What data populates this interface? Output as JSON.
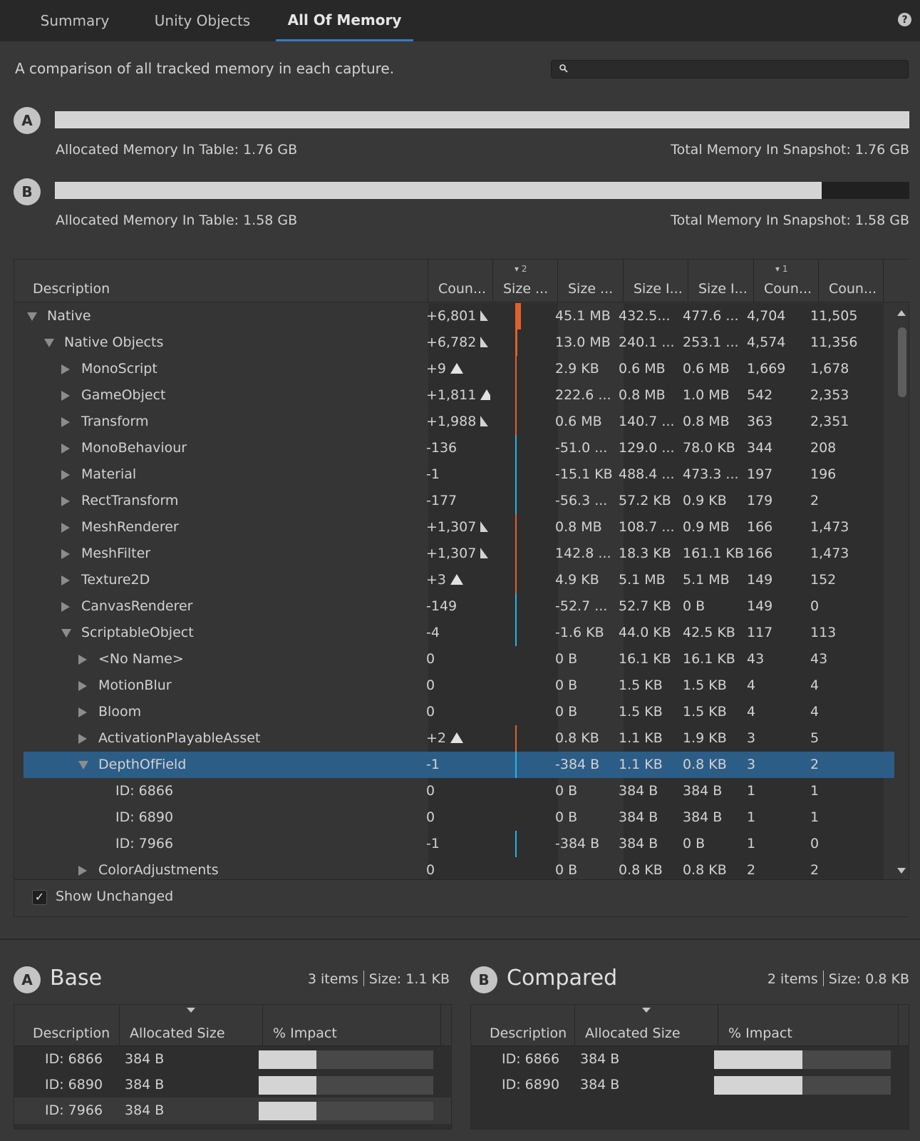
{
  "tabs": [
    {
      "label": "Summary",
      "active": false
    },
    {
      "label": "Unity Objects",
      "active": false
    },
    {
      "label": "All Of Memory",
      "active": true
    }
  ],
  "help_icon": "question-icon",
  "description": "A comparison of all tracked memory in each capture.",
  "search": {
    "placeholder": "",
    "value": ""
  },
  "captures": [
    {
      "badge": "A",
      "allocated": "Allocated Memory In Table: 1.76 GB",
      "total": "Total Memory In Snapshot: 1.76 GB",
      "fill_fraction": 1.0
    },
    {
      "badge": "B",
      "allocated": "Allocated Memory In Table: 1.58 GB",
      "total": "Total Memory In Snapshot: 1.58 GB",
      "fill_fraction": 0.897
    }
  ],
  "table": {
    "columns": [
      {
        "label": "Description",
        "sort": ""
      },
      {
        "label": "Coun...",
        "sort": ""
      },
      {
        "label": "Size ...",
        "sort": "▾ 2"
      },
      {
        "label": "Size ...",
        "sort": ""
      },
      {
        "label": "Size I...",
        "sort": ""
      },
      {
        "label": "Size I...",
        "sort": ""
      },
      {
        "label": "Coun...",
        "sort": "▾ 1"
      },
      {
        "label": "Coun...",
        "sort": ""
      }
    ],
    "colors": {
      "increase": "#e0602c",
      "decrease": "#2ab4de",
      "selected": "#2c5d87"
    },
    "rows": [
      {
        "depth": 0,
        "expander": "down",
        "desc": "Native",
        "count_diff": "+6,801",
        "arrow": "small",
        "diff": "increase",
        "diff_width": 8,
        "size_diff": "45.1 MB",
        "size_a": "432.5...",
        "size_b": "477.6 ...",
        "count_a": "4,704",
        "count_b": "11,505"
      },
      {
        "depth": 1,
        "expander": "down",
        "desc": "Native Objects",
        "count_diff": "+6,782",
        "arrow": "small",
        "diff": "increase",
        "diff_width": 3,
        "size_diff": "13.0 MB",
        "size_a": "240.1 ...",
        "size_b": "253.1 ...",
        "count_a": "4,574",
        "count_b": "11,356"
      },
      {
        "depth": 2,
        "expander": "right",
        "desc": "MonoScript",
        "count_diff": "+9",
        "arrow": "big",
        "diff": "increase",
        "diff_width": 2,
        "size_diff": "2.9 KB",
        "size_a": "0.6 MB",
        "size_b": "0.6 MB",
        "count_a": "1,669",
        "count_b": "1,678"
      },
      {
        "depth": 2,
        "expander": "right",
        "desc": "GameObject",
        "count_diff": "+1,811",
        "arrow": "big",
        "diff": "increase",
        "diff_width": 2,
        "size_diff": "222.6 ...",
        "size_a": "0.8 MB",
        "size_b": "1.0 MB",
        "count_a": "542",
        "count_b": "2,353"
      },
      {
        "depth": 2,
        "expander": "right",
        "desc": "Transform",
        "count_diff": "+1,988",
        "arrow": "small",
        "diff": "increase",
        "diff_width": 2,
        "size_diff": "0.6 MB",
        "size_a": "140.7 ...",
        "size_b": "0.8 MB",
        "count_a": "363",
        "count_b": "2,351"
      },
      {
        "depth": 2,
        "expander": "right",
        "desc": "MonoBehaviour",
        "count_diff": "-136",
        "arrow": "",
        "diff": "decrease",
        "diff_width": 2,
        "size_diff": "-51.0 ...",
        "size_a": "129.0 ...",
        "size_b": "78.0 KB",
        "count_a": "344",
        "count_b": "208"
      },
      {
        "depth": 2,
        "expander": "right",
        "desc": "Material",
        "count_diff": "-1",
        "arrow": "",
        "diff": "decrease",
        "diff_width": 2,
        "size_diff": "-15.1 KB",
        "size_a": "488.4 ...",
        "size_b": "473.3 ...",
        "count_a": "197",
        "count_b": "196"
      },
      {
        "depth": 2,
        "expander": "right",
        "desc": "RectTransform",
        "count_diff": "-177",
        "arrow": "",
        "diff": "decrease",
        "diff_width": 2,
        "size_diff": "-56.3 ...",
        "size_a": "57.2 KB",
        "size_b": "0.9 KB",
        "count_a": "179",
        "count_b": "2"
      },
      {
        "depth": 2,
        "expander": "right",
        "desc": "MeshRenderer",
        "count_diff": "+1,307",
        "arrow": "small",
        "diff": "increase",
        "diff_width": 2,
        "size_diff": "0.8 MB",
        "size_a": "108.7 ...",
        "size_b": "0.9 MB",
        "count_a": "166",
        "count_b": "1,473"
      },
      {
        "depth": 2,
        "expander": "right",
        "desc": "MeshFilter",
        "count_diff": "+1,307",
        "arrow": "small",
        "diff": "increase",
        "diff_width": 2,
        "size_diff": "142.8 ...",
        "size_a": "18.3 KB",
        "size_b": "161.1 KB",
        "count_a": "166",
        "count_b": "1,473"
      },
      {
        "depth": 2,
        "expander": "right",
        "desc": "Texture2D",
        "count_diff": "+3",
        "arrow": "big",
        "diff": "increase",
        "diff_width": 2,
        "size_diff": "4.9 KB",
        "size_a": "5.1 MB",
        "size_b": "5.1 MB",
        "count_a": "149",
        "count_b": "152"
      },
      {
        "depth": 2,
        "expander": "right",
        "desc": "CanvasRenderer",
        "count_diff": "-149",
        "arrow": "",
        "diff": "decrease",
        "diff_width": 2,
        "size_diff": "-52.7 ...",
        "size_a": "52.7 KB",
        "size_b": "0 B",
        "count_a": "149",
        "count_b": "0"
      },
      {
        "depth": 2,
        "expander": "down",
        "desc": "ScriptableObject",
        "count_diff": "-4",
        "arrow": "",
        "diff": "decrease",
        "diff_width": 2,
        "size_diff": "-1.6 KB",
        "size_a": "44.0 KB",
        "size_b": "42.5 KB",
        "count_a": "117",
        "count_b": "113"
      },
      {
        "depth": 3,
        "expander": "right",
        "desc": "<No Name>",
        "count_diff": "0",
        "arrow": "",
        "diff": "",
        "diff_width": 0,
        "size_diff": "0 B",
        "size_a": "16.1 KB",
        "size_b": "16.1 KB",
        "count_a": "43",
        "count_b": "43"
      },
      {
        "depth": 3,
        "expander": "right",
        "desc": "MotionBlur",
        "count_diff": "0",
        "arrow": "",
        "diff": "",
        "diff_width": 0,
        "size_diff": "0 B",
        "size_a": "1.5 KB",
        "size_b": "1.5 KB",
        "count_a": "4",
        "count_b": "4"
      },
      {
        "depth": 3,
        "expander": "right",
        "desc": "Bloom",
        "count_diff": "0",
        "arrow": "",
        "diff": "",
        "diff_width": 0,
        "size_diff": "0 B",
        "size_a": "1.5 KB",
        "size_b": "1.5 KB",
        "count_a": "4",
        "count_b": "4"
      },
      {
        "depth": 3,
        "expander": "right",
        "desc": "ActivationPlayableAsset",
        "count_diff": "+2",
        "arrow": "big",
        "diff": "increase",
        "diff_width": 2,
        "size_diff": "0.8 KB",
        "size_a": "1.1 KB",
        "size_b": "1.9 KB",
        "count_a": "3",
        "count_b": "5"
      },
      {
        "depth": 3,
        "expander": "down",
        "desc": "DepthOfField",
        "count_diff": "-1",
        "arrow": "",
        "diff": "decrease",
        "diff_width": 2,
        "size_diff": "-384 B",
        "size_a": "1.1 KB",
        "size_b": "0.8 KB",
        "count_a": "3",
        "count_b": "2",
        "selected": true
      },
      {
        "depth": 4,
        "expander": "",
        "desc": "ID: 6866",
        "count_diff": "0",
        "arrow": "",
        "diff": "",
        "diff_width": 0,
        "size_diff": "0 B",
        "size_a": "384 B",
        "size_b": "384 B",
        "count_a": "1",
        "count_b": "1"
      },
      {
        "depth": 4,
        "expander": "",
        "desc": "ID: 6890",
        "count_diff": "0",
        "arrow": "",
        "diff": "",
        "diff_width": 0,
        "size_diff": "0 B",
        "size_a": "384 B",
        "size_b": "384 B",
        "count_a": "1",
        "count_b": "1"
      },
      {
        "depth": 4,
        "expander": "",
        "desc": "ID: 7966",
        "count_diff": "-1",
        "arrow": "",
        "diff": "decrease",
        "diff_width": 2,
        "size_diff": "-384 B",
        "size_a": "384 B",
        "size_b": "0 B",
        "count_a": "1",
        "count_b": "0"
      },
      {
        "depth": 3,
        "expander": "right",
        "desc": "ColorAdjustments",
        "count_diff": "0",
        "arrow": "",
        "diff": "",
        "diff_width": 0,
        "size_diff": "0 B",
        "size_a": "0.8 KB",
        "size_b": "0.8 KB",
        "count_a": "2",
        "count_b": "2"
      }
    ]
  },
  "show_unchanged": {
    "label": "Show Unchanged",
    "checked": true,
    "check_glyph": "✓"
  },
  "panels": [
    {
      "badge": "A",
      "title": "Base",
      "items": "3 items",
      "size": "Size: 1.1 KB",
      "columns": [
        "Description",
        "Allocated Size",
        "% Impact"
      ],
      "rows": [
        {
          "desc": "ID: 6866",
          "size": "384 B",
          "impact": 0.33,
          "highlight": false
        },
        {
          "desc": "ID: 6890",
          "size": "384 B",
          "impact": 0.33,
          "highlight": false
        },
        {
          "desc": "ID: 7966",
          "size": "384 B",
          "impact": 0.33,
          "highlight": true
        }
      ]
    },
    {
      "badge": "B",
      "title": "Compared",
      "items": "2 items",
      "size": "Size: 0.8 KB",
      "columns": [
        "Description",
        "Allocated Size",
        "% Impact"
      ],
      "rows": [
        {
          "desc": "ID: 6866",
          "size": "384 B",
          "impact": 0.5,
          "highlight": false
        },
        {
          "desc": "ID: 6890",
          "size": "384 B",
          "impact": 0.5,
          "highlight": false
        }
      ]
    }
  ]
}
